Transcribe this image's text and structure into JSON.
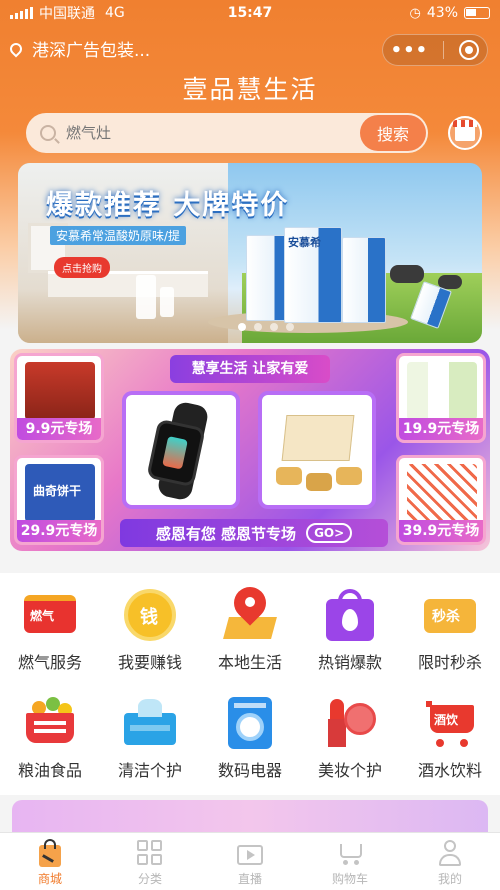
{
  "status_bar": {
    "carrier": "中国联通",
    "network": "4G",
    "time": "15:47",
    "battery": "43%"
  },
  "location": {
    "text": "港深广告包装..."
  },
  "app_title": "壹品慧生活",
  "search": {
    "placeholder": "燃气灶",
    "button": "搜索"
  },
  "banner": {
    "headline": "爆款推荐 大牌特价",
    "subline": "安慕希常温酸奶原味/提",
    "cta": "点击抢购",
    "product_brand": "安慕希"
  },
  "promo": {
    "title": "慧享生活 让家有爱",
    "cells": [
      {
        "label": "9.9元专场"
      },
      {
        "label": "19.9元专场"
      },
      {
        "label": "29.9元专场",
        "product_text": "曲奇饼干"
      },
      {
        "label": "39.9元专场"
      }
    ],
    "bottom_text": "感恩有您 感恩节专场",
    "go": "GO>"
  },
  "categories": [
    {
      "label": "燃气服务",
      "icon": "gas-icon",
      "badge": "燃气"
    },
    {
      "label": "我要赚钱",
      "icon": "coin-icon",
      "badge": "钱"
    },
    {
      "label": "本地生活",
      "icon": "map-pin-icon"
    },
    {
      "label": "热销爆款",
      "icon": "hot-bag-icon"
    },
    {
      "label": "限时秒杀",
      "icon": "flash-sale-icon",
      "badge": "秒杀"
    },
    {
      "label": "粮油食品",
      "icon": "grocery-basket-icon"
    },
    {
      "label": "清洁个护",
      "icon": "tissue-icon"
    },
    {
      "label": "数码电器",
      "icon": "washing-machine-icon"
    },
    {
      "label": "美妆个护",
      "icon": "lipstick-icon"
    },
    {
      "label": "酒水饮料",
      "icon": "drinks-cart-icon",
      "badge": "酒饮"
    }
  ],
  "tabs": [
    {
      "label": "商城",
      "icon": "shop-bag-icon",
      "active": true
    },
    {
      "label": "分类",
      "icon": "grid-icon",
      "active": false
    },
    {
      "label": "直播",
      "icon": "live-tv-icon",
      "active": false
    },
    {
      "label": "购物车",
      "icon": "cart-icon",
      "active": false
    },
    {
      "label": "我的",
      "icon": "user-icon",
      "active": false
    }
  ]
}
